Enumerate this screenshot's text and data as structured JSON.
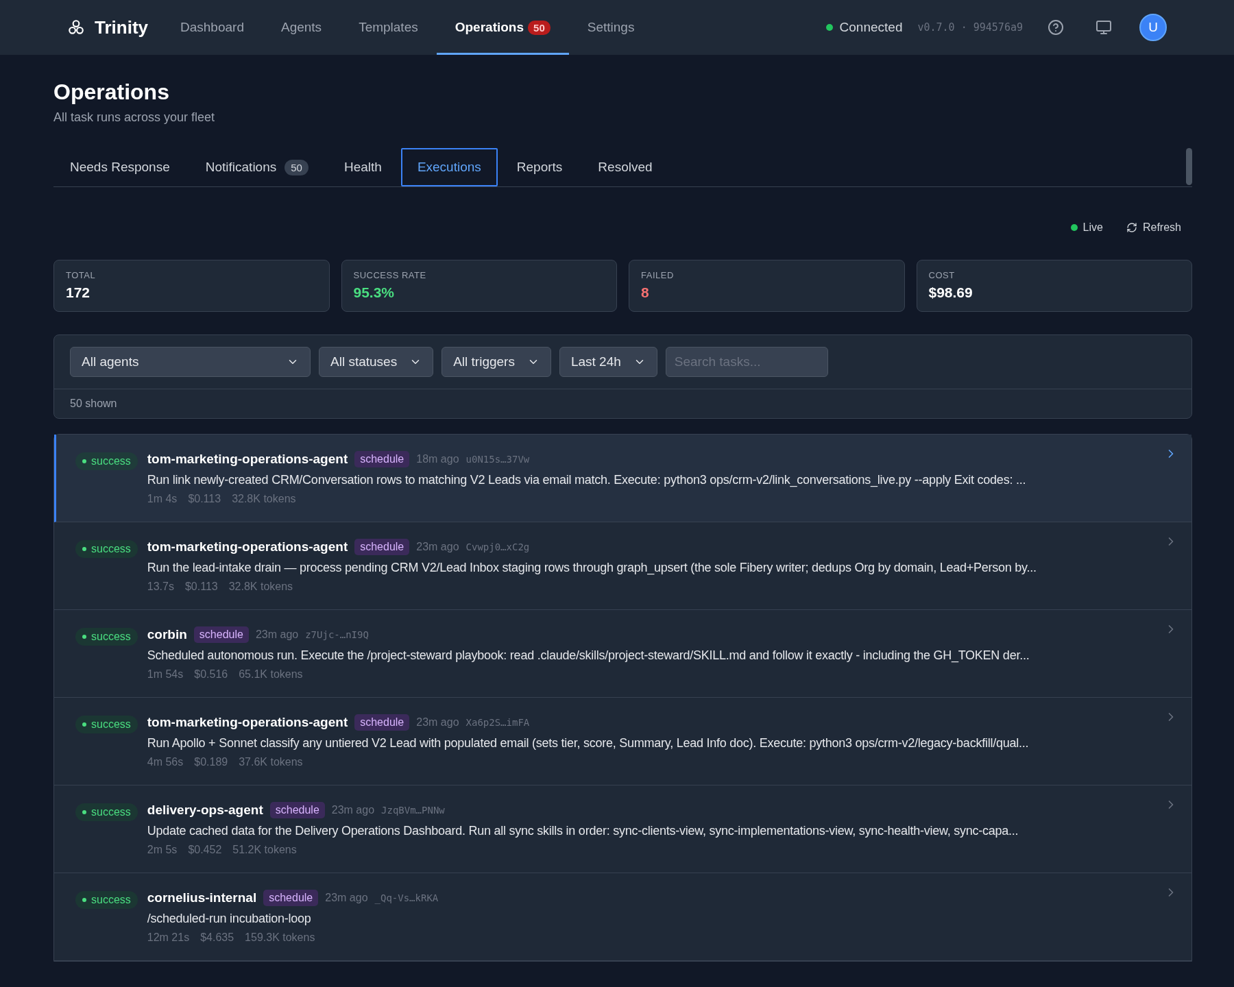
{
  "brand": {
    "name": "Trinity"
  },
  "nav": [
    {
      "label": "Dashboard",
      "selected": false
    },
    {
      "label": "Agents",
      "selected": false
    },
    {
      "label": "Templates",
      "selected": false
    },
    {
      "label": "Operations",
      "selected": true,
      "badge": "50"
    },
    {
      "label": "Settings",
      "selected": false
    }
  ],
  "connection": {
    "label": "Connected",
    "on": true,
    "version": "v0.7.0 · 994576a9"
  },
  "user": {
    "initial": "U"
  },
  "page": {
    "title": "Operations",
    "subtitle": "All task runs across your fleet"
  },
  "tabs": [
    {
      "label": "Needs Response",
      "selected": false
    },
    {
      "label": "Notifications",
      "selected": false,
      "badge": "50"
    },
    {
      "label": "Health",
      "selected": false
    },
    {
      "label": "Executions",
      "selected": true
    },
    {
      "label": "Reports",
      "selected": false
    },
    {
      "label": "Resolved",
      "selected": false
    }
  ],
  "live": {
    "label": "Live",
    "on": true
  },
  "refresh": {
    "label": "Refresh"
  },
  "stats": [
    {
      "label": "TOTAL",
      "value": "172",
      "kind": "neutral"
    },
    {
      "label": "SUCCESS RATE",
      "value": "95.3%",
      "kind": "good"
    },
    {
      "label": "FAILED",
      "value": "8",
      "kind": "bad"
    },
    {
      "label": "COST",
      "value": "$98.69",
      "kind": "neutral"
    }
  ],
  "filters": [
    {
      "value": "All agents",
      "wide": true
    },
    {
      "value": "All statuses",
      "wide": false
    },
    {
      "value": "All triggers",
      "wide": false
    },
    {
      "value": "Last 24h",
      "wide": false
    }
  ],
  "search": {
    "placeholder": "Search tasks..."
  },
  "shown": "50 shown",
  "runs": [
    {
      "status": "success",
      "agent": "tom-marketing-operations-agent",
      "trigger": "schedule",
      "time": "18m ago",
      "id": "u0N15s…37Vw",
      "description": "Run link newly-created CRM/Conversation rows to matching V2 Leads via email match. Execute: python3 ops/crm-v2/link_conversations_live.py --apply Exit codes: ...",
      "duration": "1m 4s",
      "cost": "$0.113",
      "tokens": "32.8K tokens",
      "selected": true
    },
    {
      "status": "success",
      "agent": "tom-marketing-operations-agent",
      "trigger": "schedule",
      "time": "23m ago",
      "id": "Cvwpj0…xC2g",
      "description": "Run the lead-intake drain — process pending CRM V2/Lead Inbox staging rows through graph_upsert (the sole Fibery writer; dedups Org by domain, Lead+Person by...",
      "duration": "13.7s",
      "cost": "$0.113",
      "tokens": "32.8K tokens",
      "selected": false
    },
    {
      "status": "success",
      "agent": "corbin",
      "trigger": "schedule",
      "time": "23m ago",
      "id": "z7Ujc-…nI9Q",
      "description": "Scheduled autonomous run. Execute the /project-steward playbook: read .claude/skills/project-steward/SKILL.md and follow it exactly - including the GH_TOKEN der...",
      "duration": "1m 54s",
      "cost": "$0.516",
      "tokens": "65.1K tokens",
      "selected": false
    },
    {
      "status": "success",
      "agent": "tom-marketing-operations-agent",
      "trigger": "schedule",
      "time": "23m ago",
      "id": "Xa6p2S…imFA",
      "description": "Run Apollo + Sonnet classify any untiered V2 Lead with populated email (sets tier, score, Summary, Lead Info doc). Execute: python3 ops/crm-v2/legacy-backfill/qual...",
      "duration": "4m 56s",
      "cost": "$0.189",
      "tokens": "37.6K tokens",
      "selected": false
    },
    {
      "status": "success",
      "agent": "delivery-ops-agent",
      "trigger": "schedule",
      "time": "23m ago",
      "id": "JzqBVm…PNNw",
      "description": "Update cached data for the Delivery Operations Dashboard. Run all sync skills in order: sync-clients-view, sync-implementations-view, sync-health-view, sync-capa...",
      "duration": "2m 5s",
      "cost": "$0.452",
      "tokens": "51.2K tokens",
      "selected": false
    },
    {
      "status": "success",
      "agent": "cornelius-internal",
      "trigger": "schedule",
      "time": "23m ago",
      "id": "_Qq-Vs…kRKA",
      "description": "/scheduled-run incubation-loop",
      "duration": "12m 21s",
      "cost": "$4.635",
      "tokens": "159.3K tokens",
      "selected": false
    }
  ]
}
